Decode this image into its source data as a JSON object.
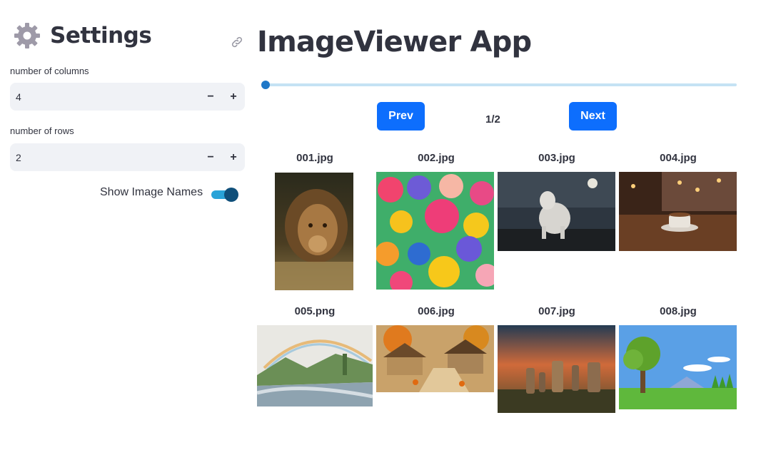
{
  "sidebar": {
    "title": "Settings",
    "columns": {
      "label": "number of columns",
      "value": "4",
      "minus": "−",
      "plus": "+"
    },
    "rows": {
      "label": "number of rows",
      "value": "2",
      "minus": "−",
      "plus": "+"
    },
    "toggle": {
      "label": "Show Image Names",
      "state": "on"
    }
  },
  "main": {
    "title": "ImageViewer App",
    "slider": {
      "value": 1,
      "min": 1,
      "max": 2
    },
    "prev_label": "Prev",
    "next_label": "Next",
    "page_indicator": "1/2",
    "images": [
      {
        "name": "001.jpg",
        "subject": "lion"
      },
      {
        "name": "002.jpg",
        "subject": "flowers"
      },
      {
        "name": "003.jpg",
        "subject": "wolf-moon"
      },
      {
        "name": "004.jpg",
        "subject": "coffee-cup"
      },
      {
        "name": "005.png",
        "subject": "rainbow-river"
      },
      {
        "name": "006.jpg",
        "subject": "autumn-village"
      },
      {
        "name": "007.jpg",
        "subject": "standing-stones"
      },
      {
        "name": "008.jpg",
        "subject": "tree-meadow"
      }
    ]
  },
  "colors": {
    "accent": "#0d6efd",
    "toggle_track": "#29a3d8",
    "toggle_knob": "#0f4f7a",
    "stepper_bg": "#f0f2f6",
    "text": "#31333f"
  }
}
